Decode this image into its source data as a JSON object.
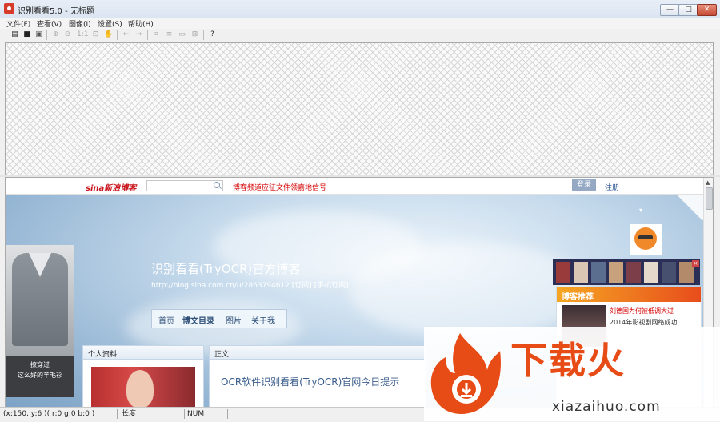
{
  "window": {
    "title": "识别看看5.0  - 无标题",
    "minimize": "—",
    "maximize": "□",
    "close": "✕"
  },
  "menu": [
    "文件(F)",
    "查看(V)",
    "图像(I)",
    "设置(S)",
    "帮助(H)"
  ],
  "toolbar_icons": [
    "open-folder",
    "save",
    "save-all",
    "zoom-in",
    "zoom-out",
    "actual-size",
    "fit-window",
    "pan-hand",
    "rotate-left",
    "rotate-right",
    "crop",
    "deskew",
    "select-all",
    "region-select",
    "help"
  ],
  "browser": {
    "sina_logo": "sina新浪博客",
    "search_placeholder": "",
    "notice": "博客频道应征文件领嘉地信号",
    "login": "登录",
    "register": "注册",
    "blog_title": "识别看看(TryOCR)官方博客",
    "blog_url": "http://blog.sina.com.cn/u/2863794612  [订阅] [手机订阅]",
    "nav": [
      "首页",
      "博文目录",
      "图片",
      "关于我"
    ],
    "sweater_ad": [
      "撩穿过",
      "这么好的羊毛衫"
    ],
    "profile_heading": "个人资料",
    "body_heading": "正文",
    "post_title": "OCR软件识别看看(TryOCR)官网今日提示",
    "recommend_heading": "博客推荐",
    "recommend_lines": [
      "刘德国为何被低调大过",
      "2014年影视剧网络成功"
    ]
  },
  "status": {
    "coords": "(x:150, y:6 )( r:0 g:0 b:0 )",
    "length": "长度",
    "num": "NUM"
  },
  "watermark": {
    "brand": "下载火",
    "url": "xiazaihuo.com"
  },
  "colors": {
    "accent_red": "#d40000",
    "brand_orange": "#e84c16",
    "link_blue": "#1b4a8a"
  }
}
